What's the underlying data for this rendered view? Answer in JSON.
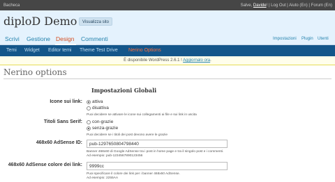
{
  "topbar": {
    "site": "Bacheca",
    "howdy_prefix": "Salve, ",
    "user_name": "Davide",
    "rest": "! | Log Out | Aiuto (En) | Forum (En)"
  },
  "header": {
    "blog_title": "diploD Demo",
    "visit_site": "Visualizza sito"
  },
  "main_nav": {
    "tabs": [
      "Scrivi",
      "Gestione",
      "Design",
      "Commenti"
    ],
    "active": "Design",
    "right_links": [
      "Impostazioni",
      "Plugin",
      "Utenti"
    ]
  },
  "sub_nav": {
    "items": [
      "Temi",
      "Widget",
      "Editor temi",
      "Theme Test Drive",
      "Nerino Options"
    ],
    "active": "Nerino Options"
  },
  "notice": {
    "text": "È disponibile WordPress 2.6.1 ! ",
    "link": "Aggiornalo ora",
    "end": "."
  },
  "page": {
    "title": "Nerino options",
    "section_title": "Impostazioni Globali"
  },
  "settings": {
    "icons": {
      "label": "Icone sui link:",
      "options": [
        "attiva",
        "disattiva"
      ],
      "selected": "attiva",
      "help": "Puoi decidere se attivare le icone sui collegamenti ai file e sui link in uscita"
    },
    "titles": {
      "label": "Titoli Sans Serif:",
      "options": [
        "con-grazie",
        "senza-grazie"
      ],
      "selected": "senza-grazie",
      "help": "Puoi decidere se i titoli dei post devono avere le grazie"
    },
    "adsense_id": {
      "label": "468x60 AdSense ID:",
      "value": "pub-1297650804798440",
      "help_1": "Banner 468x60 di Google AdSense tra i post in home page e tra il singolo post e i commenti.",
      "help_2": "Ad esempio: pub-1234567890123456"
    },
    "adsense_color": {
      "label": "468x60 AdSense colore dei link:",
      "value": "9999cc",
      "help_1": "Puoi specificare il colore dei link per i banner 468x60 AdSense.",
      "help_2": "Ad esempio: 2255AA"
    }
  },
  "colors": {
    "header_bg": "#e4f2fd",
    "subnav_bg": "#14568a",
    "active_tab": "#d54e21",
    "link": "#2583ad"
  }
}
